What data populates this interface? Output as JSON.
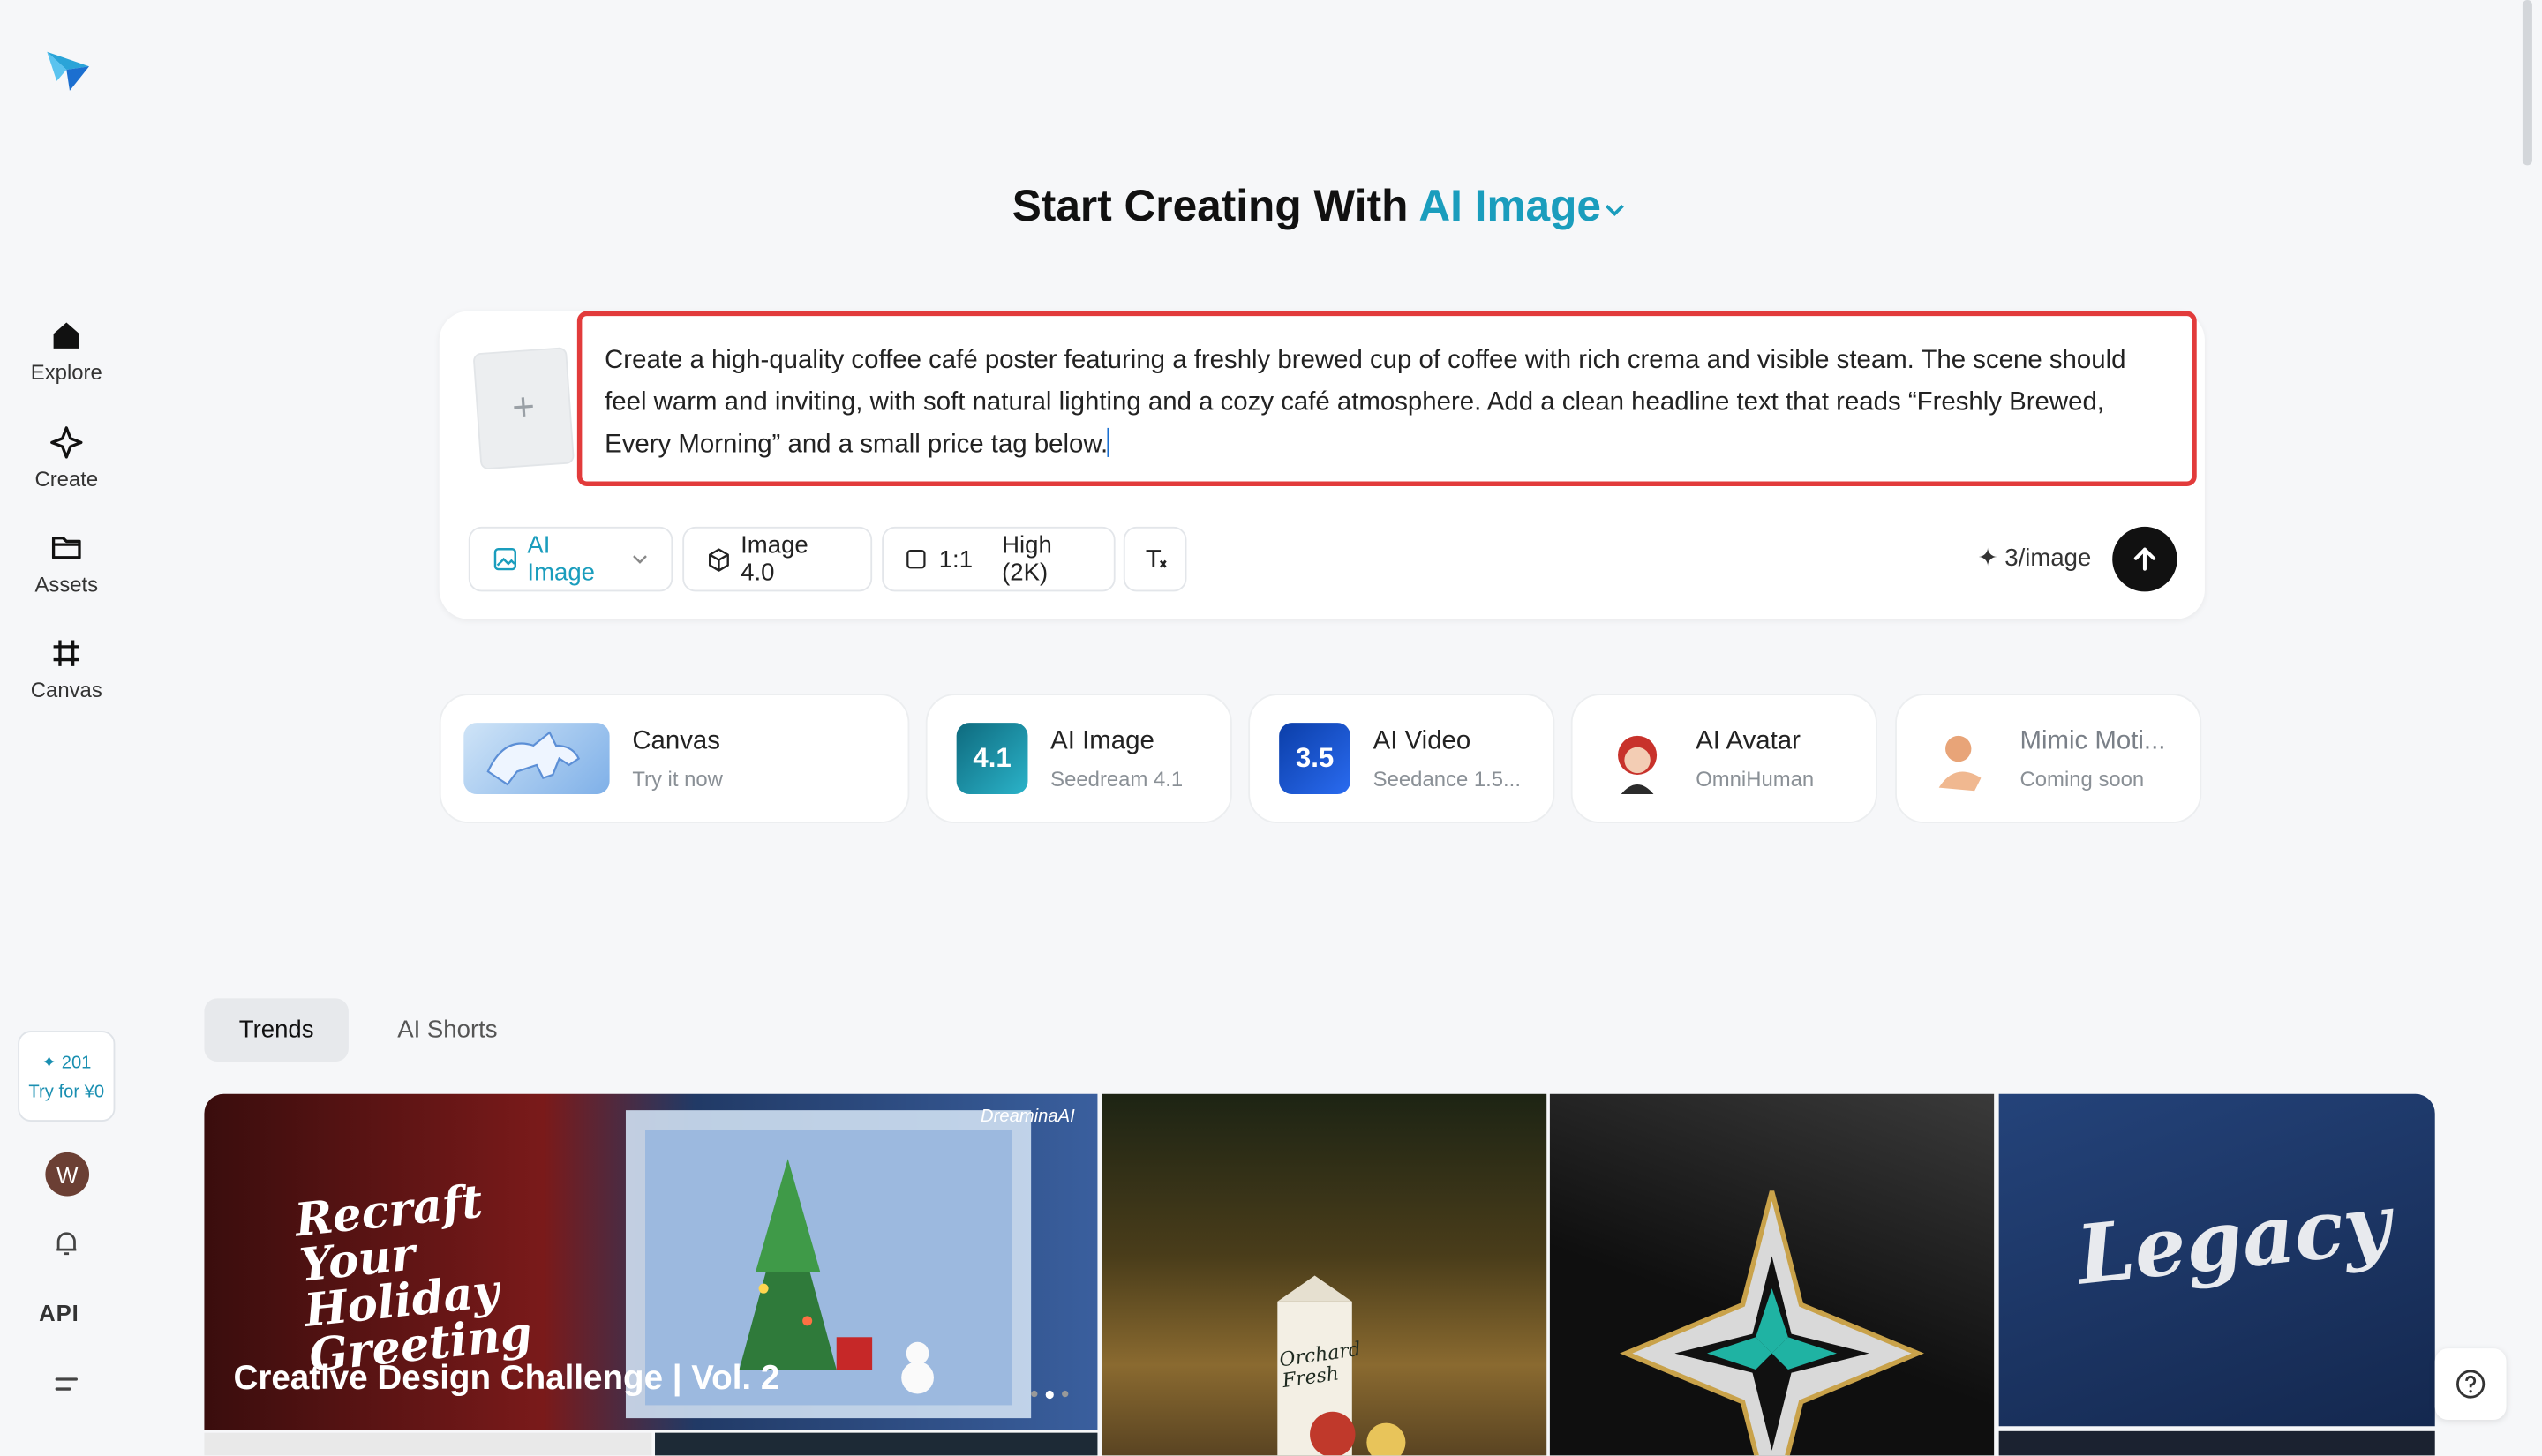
{
  "sidebar": {
    "nav": [
      {
        "label": "Explore",
        "icon": "home-icon"
      },
      {
        "label": "Create",
        "icon": "sparkle-icon"
      },
      {
        "label": "Assets",
        "icon": "folder-icon"
      },
      {
        "label": "Canvas",
        "icon": "crop-icon"
      }
    ],
    "credits": "201",
    "try_label": "Try for ¥0",
    "avatar_letter": "W",
    "api_label": "API"
  },
  "header": {
    "prefix": "Start Creating With",
    "mode": "AI Image"
  },
  "prompt": {
    "text": "Create a high-quality coffee café poster featuring a freshly brewed cup of coffee with rich crema and visible steam. The scene should feel warm and inviting, with soft natural lighting and a cozy café atmosphere. Add a clean headline text that reads “Freshly Brewed, Every Morning” and a small price tag below.",
    "upload_symbol": "+"
  },
  "toolbar": {
    "mode_label": "AI Image",
    "model_label": "Image 4.0",
    "ratio_label": "1:1",
    "quality_label": "High (2K)",
    "cost_label": "3/image"
  },
  "features": [
    {
      "title": "Canvas",
      "subtitle": "Try it now",
      "badge": ""
    },
    {
      "title": "AI Image",
      "subtitle": "Seedream 4.1",
      "badge": "4.1"
    },
    {
      "title": "AI Video",
      "subtitle": "Seedance 1.5...",
      "badge": "3.5"
    },
    {
      "title": "AI Avatar",
      "subtitle": "OmniHuman",
      "badge": ""
    },
    {
      "title": "Mimic Moti...",
      "subtitle": "Coming soon",
      "badge": ""
    }
  ],
  "tabs": [
    {
      "label": "Trends",
      "active": true
    },
    {
      "label": "AI Shorts",
      "active": false
    }
  ],
  "gallery": {
    "banner_script": "Recraft Your Holiday Greeting",
    "banner_title": "Creative Design Challenge | Vol. 2",
    "banner_brand": "DreaminaAI",
    "carton_label": "Orchard Fresh",
    "legacy_text": "Legacy"
  },
  "colors": {
    "accent": "#1a9dbd",
    "highlight_border": "#e23b3b",
    "send_button": "#111111"
  }
}
